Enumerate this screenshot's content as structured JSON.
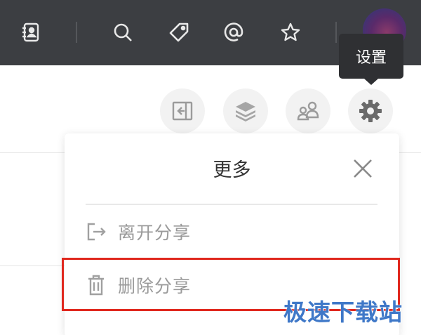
{
  "topbar": {
    "icons": [
      "contacts-book-icon",
      "search-icon",
      "tag-icon",
      "at-mention-icon",
      "star-icon",
      "user-avatar"
    ]
  },
  "tooltip": {
    "label": "设置"
  },
  "toolbar": {
    "buttons": [
      "collapse-panel-icon",
      "layers-icon",
      "members-icon",
      "settings-gear-icon"
    ]
  },
  "more_panel": {
    "title": "更多",
    "items": [
      {
        "label": "离开分享",
        "icon": "exit-icon"
      },
      {
        "label": "删除分享",
        "icon": "trash-icon"
      }
    ]
  },
  "watermark": {
    "text": "极速下载站"
  },
  "colors": {
    "topbar_bg": "#3c3e42",
    "tooltip_bg": "#2f3033",
    "highlight_border": "#e0281e",
    "watermark": "#3f78c8",
    "muted_text": "#9a9a9a"
  }
}
